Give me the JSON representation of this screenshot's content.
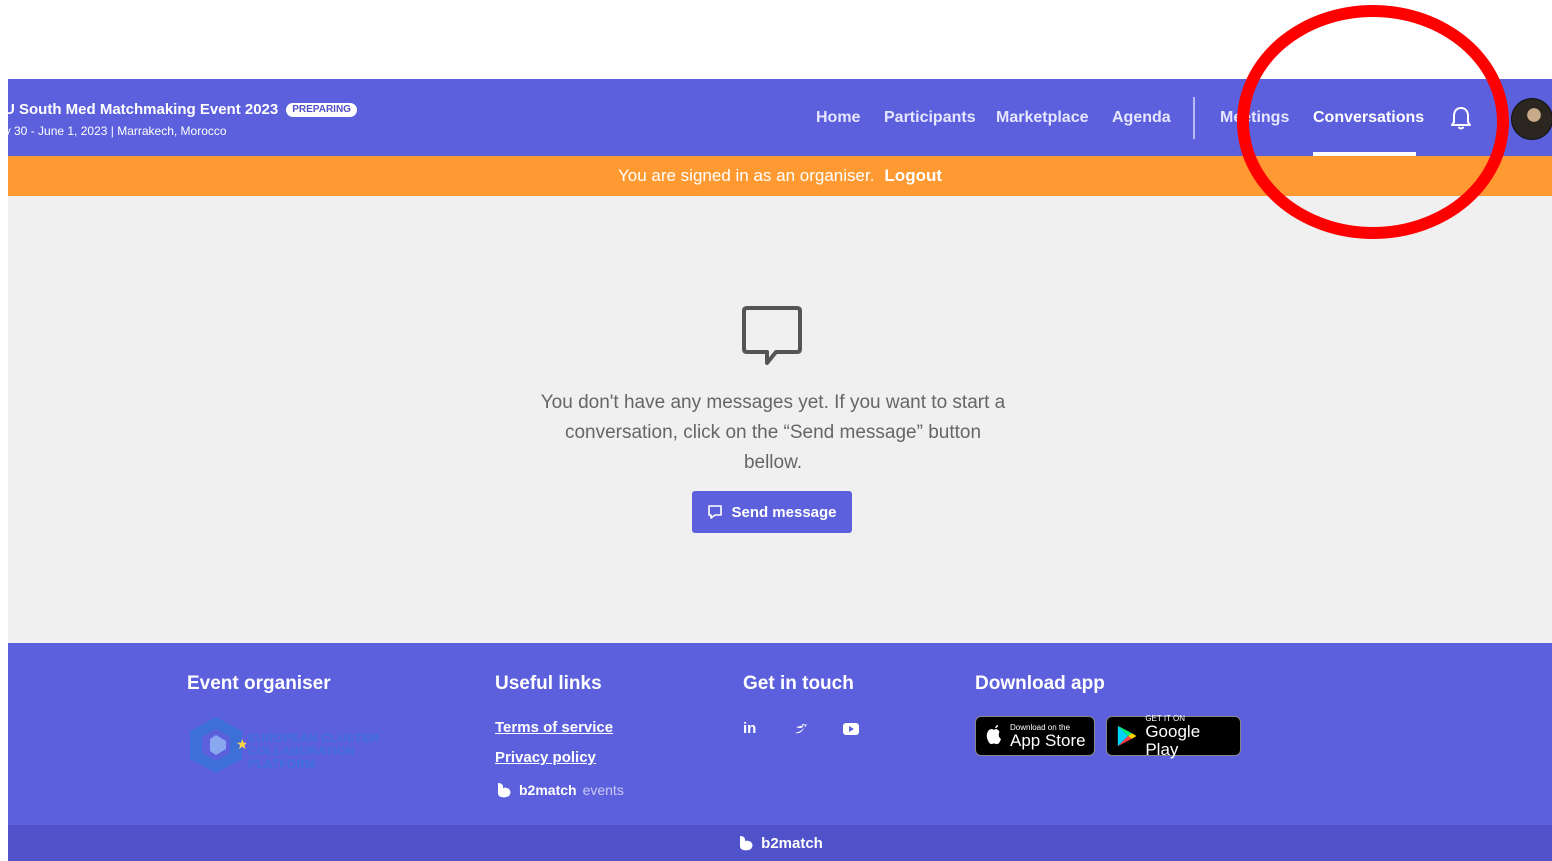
{
  "header": {
    "event_title": "U South Med Matchmaking Event 2023",
    "status_badge": "PREPARING",
    "event_subtitle": "ay 30 - June 1, 2023 | Marrakech, Morocco",
    "nav": [
      {
        "label": "Home"
      },
      {
        "label": "Participants"
      },
      {
        "label": "Marketplace"
      },
      {
        "label": "Agenda"
      },
      {
        "label": "Meetings"
      },
      {
        "label": "Conversations",
        "active": true
      }
    ],
    "icons": {
      "bell": "bell-icon",
      "avatar": "user-avatar"
    }
  },
  "banner": {
    "text": "You are signed in as an organiser.",
    "logout": "Logout"
  },
  "empty_state": {
    "icon": "chat-bubble-icon",
    "message": "You don't have any messages yet. If you want to start a conversation, click on the “Send message” button bellow.",
    "button": "Send message"
  },
  "footer": {
    "organiser_heading": "Event organiser",
    "organiser_logo_text": [
      "EUROPEAN CLUSTER",
      "COLLABORATION PLATFORM"
    ],
    "links_heading": "Useful links",
    "links": [
      "Terms of service",
      "Privacy policy"
    ],
    "powered_brand": "b2match",
    "powered_sub": "events",
    "touch_heading": "Get in touch",
    "social": [
      "in",
      "twitter-icon",
      "youtube-icon"
    ],
    "app_heading": "Download app",
    "app_store": {
      "small": "Download on the",
      "big": "App Store"
    },
    "google_play": {
      "small": "GET IT ON",
      "big": "Google Play"
    },
    "bottom_brand": "b2match"
  },
  "colors": {
    "primary": "#5c60dc",
    "banner": "#ff9a32",
    "annotation": "#ff0000",
    "background": "#f0f0f0"
  }
}
